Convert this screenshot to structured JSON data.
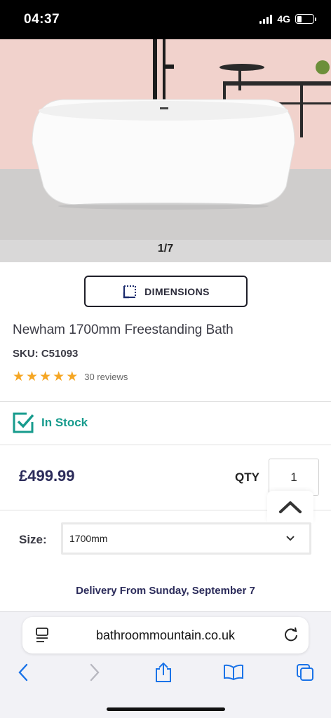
{
  "status_bar": {
    "time": "04:37",
    "network": "4G"
  },
  "gallery": {
    "counter": "1/7"
  },
  "dimensions_button": {
    "label": "DIMENSIONS"
  },
  "product": {
    "title": "Newham 1700mm Freestanding Bath",
    "sku": "SKU: C51093",
    "rating": 5,
    "reviews": "30 reviews"
  },
  "stock": {
    "label": "In Stock"
  },
  "purchase": {
    "price": "£499.99",
    "qty_label": "QTY",
    "qty_value": "1"
  },
  "size": {
    "label": "Size:",
    "selected": "1700mm"
  },
  "delivery": {
    "text": "Delivery From Sunday, September 7"
  },
  "browser": {
    "url": "bathroommountain.co.uk",
    "accent_color": "#1a73e8"
  },
  "colors": {
    "stock_teal": "#179b8d",
    "star": "#f5a623",
    "navy": "#2b2b5a"
  }
}
